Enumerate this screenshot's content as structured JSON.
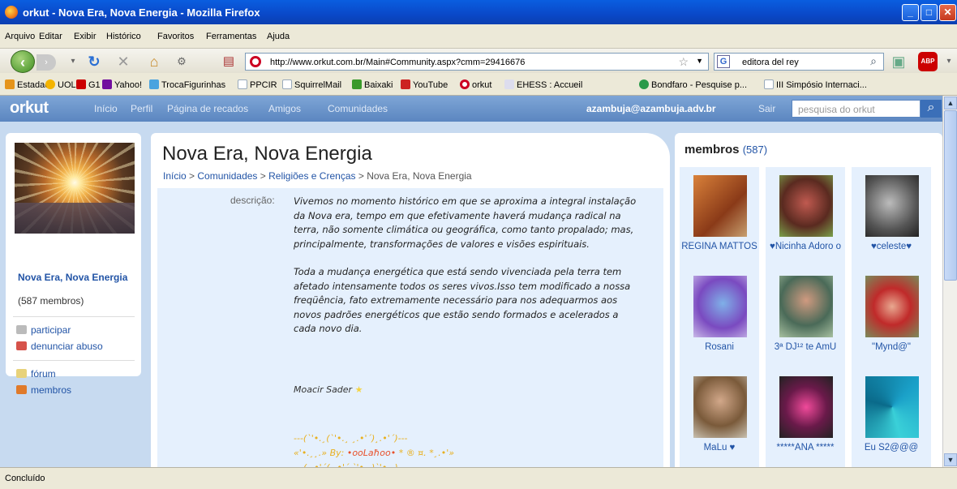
{
  "window": {
    "title": "orkut - Nova Era, Nova Energia - Mozilla Firefox"
  },
  "menu": [
    "Arquivo",
    "Editar",
    "Exibir",
    "Histórico",
    "Favoritos",
    "Ferramentas",
    "Ajuda"
  ],
  "browser": {
    "url": "http://www.orkut.com.br/Main#Community.aspx?cmm=29416676",
    "search_value": "editora del rey",
    "adblock_label": "ABP"
  },
  "bookmarks": [
    "Estadao",
    "UOL",
    "G1",
    "Yahoo!",
    "TrocaFigurinhas",
    "PPCIR",
    "SquirrelMail",
    "Baixaki",
    "YouTube",
    "orkut",
    "EHESS : Accueil",
    "Bondfaro - Pesquise p...",
    "III Simpósio Internaci..."
  ],
  "orkut_nav": {
    "logo": "orkut",
    "links": [
      "Início",
      "Perfil",
      "Página de recados",
      "Amigos",
      "Comunidades"
    ],
    "email": "azambuja@azambuja.adv.br",
    "logout": "Sair",
    "search_placeholder": "pesquisa do orkut"
  },
  "community": {
    "name": "Nova Era, Nova Energia",
    "members_count": "(587 membros)",
    "actions": [
      "participar",
      "denunciar abuso"
    ],
    "links": [
      "fórum",
      "membros"
    ]
  },
  "main": {
    "title": "Nova Era, Nova Energia",
    "breadcrumb": [
      "Início",
      "Comunidades",
      "Religiões e Crenças",
      "Nova Era, Nova Energia"
    ],
    "desc_label": "descrição:",
    "paragraphs": [
      "Vivemos no momento histórico em que se aproxima a integral instalação da Nova era, tempo em que efetivamente haverá mudança radical na terra, não somente climática ou geográfica, como tanto propalado; mas, principalmente, transformações de valores e visões espirituais.",
      "Toda a mudança energética que está sendo vivenciada pela terra tem afetado intensamente todos os seres vivos.Isso tem modificado a nossa freqüência, fato extremamente necessário para nos adequarmos aos novos padrões energéticos que estão sendo formados e acelerados a cada novo dia."
    ],
    "signature": "Moacir Sader",
    "deco_line1": "---(`'•.¸(`'•.¸ ¸.•'´)¸.•'´)---",
    "deco_line2_pre": "«'•.¸¸.» By: ",
    "deco_line2_name": "•ooLaħoo•",
    "deco_line2_post": " * ® ¤. *¸.•'»",
    "deco_line3": "---(¸.•'´(¸.•'´ `'•.¸)`'•.¸)---"
  },
  "members": {
    "title": "membros",
    "count": "(587)",
    "list": [
      {
        "name": "REGINA MATTOS"
      },
      {
        "name": "♥Nicinha Adoro o"
      },
      {
        "name": "♥celeste♥"
      },
      {
        "name": "Rosani"
      },
      {
        "name": "3ª DJ¹² te AmU"
      },
      {
        "name": "\"Mynd@\""
      },
      {
        "name": "MaLu ♥"
      },
      {
        "name": "*****ANA *****"
      },
      {
        "name": "Eu S2@@@"
      }
    ]
  },
  "status": "Concluído",
  "colors": {
    "orkut_blue": "#5b86c0",
    "link": "#2254a6",
    "desc_bg": "#e5f0fd",
    "page_bg": "#c7daf0"
  }
}
